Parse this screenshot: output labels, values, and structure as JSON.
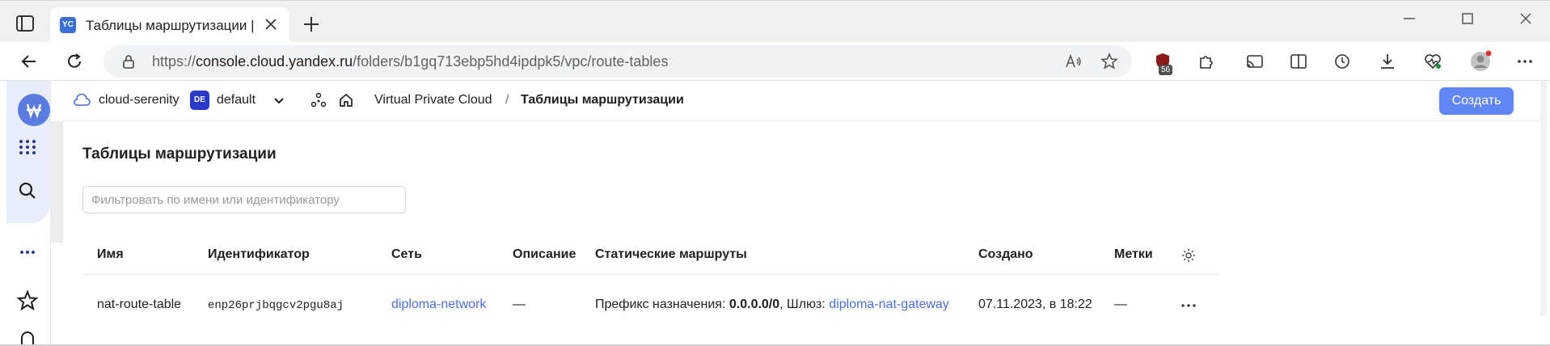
{
  "browser": {
    "tab_title": "Таблицы маршрутизации | Yandex",
    "favicon_text": "YC",
    "url_prefix": "https://",
    "url_host": "console.cloud.yandex.ru",
    "url_path": "/folders/b1gq713ebp5hd4ipdpk5/vpc/route-tables",
    "extension_badge": "56"
  },
  "header": {
    "cloud_name": "cloud-serenity",
    "folder_badge": "DE",
    "folder_name": "default",
    "breadcrumb_service": "Virtual Private Cloud",
    "breadcrumb_separator": "/",
    "breadcrumb_current": "Таблицы маршрутизации",
    "create_label": "Создать"
  },
  "page": {
    "title": "Таблицы маршрутизации",
    "filter_placeholder": "Фильтровать по имени или идентификатору"
  },
  "table": {
    "columns": {
      "name": "Имя",
      "id": "Идентификатор",
      "network": "Сеть",
      "description": "Описание",
      "routes": "Статические маршруты",
      "created": "Создано",
      "labels": "Метки"
    },
    "rows": [
      {
        "name": "nat-route-table",
        "id": "enp26prjbqgcv2pgu8aj",
        "network": "diploma-network",
        "description": "—",
        "routes_prefix_label": "Префикс назначения:",
        "routes_prefix_value": "0.0.0.0/0",
        "routes_gateway_label": ", Шлюз:",
        "routes_gateway_value": "diploma-nat-gateway",
        "created": "07.11.2023, в 18:22",
        "labels": "—"
      }
    ]
  },
  "colors": {
    "accent": "#5f86f2",
    "link": "#4b6fd7",
    "folder_badge": "#2b39c9"
  }
}
